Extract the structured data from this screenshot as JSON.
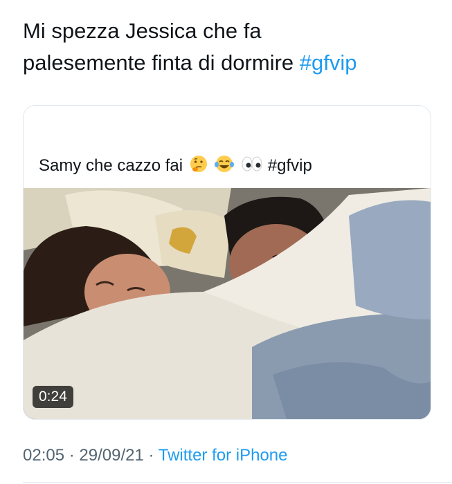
{
  "tweet": {
    "text_line1": "Mi spezza Jessica che fa",
    "text_line2": "palesemente finta di dormire",
    "hashtag": "#gfvip"
  },
  "quoted_tweet": {
    "text": "Samy che cazzo fai",
    "emojis": [
      "thinking-face-icon",
      "tears-of-joy-icon",
      "eyes-icon"
    ],
    "hashtag": "#gfvip",
    "video": {
      "duration": "0:24"
    }
  },
  "meta": {
    "time": "02:05",
    "separator": "·",
    "date": "29/09/21",
    "source": "Twitter for iPhone"
  },
  "colors": {
    "link": "#1d9bf0",
    "text": "#0f1419",
    "secondary": "#536471",
    "border": "#e1e8ed"
  }
}
